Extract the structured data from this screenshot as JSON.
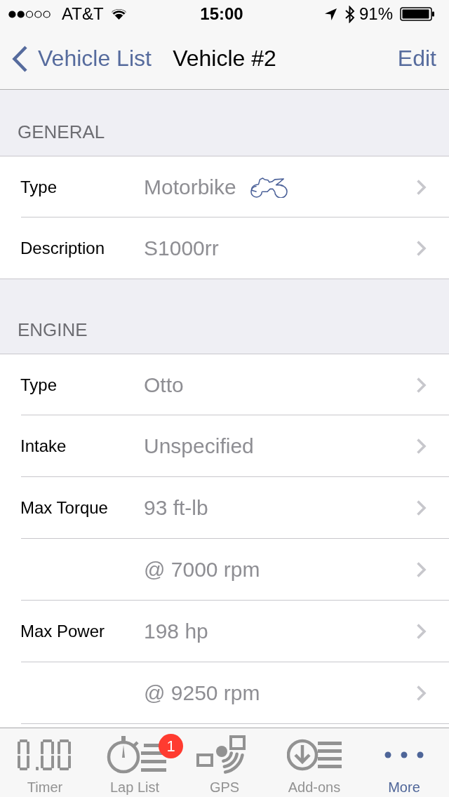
{
  "status_bar": {
    "carrier": "AT&T",
    "time": "15:00",
    "battery": "91%"
  },
  "nav_bar": {
    "back": "Vehicle List",
    "title": "Vehicle #2",
    "action": "Edit"
  },
  "sections": [
    {
      "title": "GENERAL",
      "rows": [
        {
          "kind": "icon_value",
          "label": "Type",
          "value": "Motorbike"
        },
        {
          "kind": "value",
          "label": "Description",
          "value": "S1000rr"
        }
      ]
    },
    {
      "title": "ENGINE",
      "rows": [
        {
          "kind": "value",
          "label": "Type",
          "value": "Otto"
        },
        {
          "kind": "value",
          "label": "Intake",
          "value": "Unspecified"
        },
        {
          "kind": "value",
          "label": "Max Torque",
          "value": "93 ft-lb"
        },
        {
          "kind": "value",
          "value": "@ 7000 rpm"
        },
        {
          "kind": "value",
          "label": "Max Power",
          "value": "198 hp"
        },
        {
          "kind": "value",
          "value": "@ 9250 rpm"
        }
      ]
    }
  ],
  "tab_bar": {
    "tabs": [
      {
        "kind": "timer",
        "label": "Timer",
        "selected": false
      },
      {
        "kind": "laps",
        "label": "Lap List",
        "selected": false,
        "badge": "1"
      },
      {
        "kind": "gps",
        "label": "GPS",
        "selected": false
      },
      {
        "kind": "addons",
        "label": "Add-ons",
        "selected": false
      },
      {
        "kind": "more",
        "label": "More",
        "selected": true
      }
    ]
  }
}
